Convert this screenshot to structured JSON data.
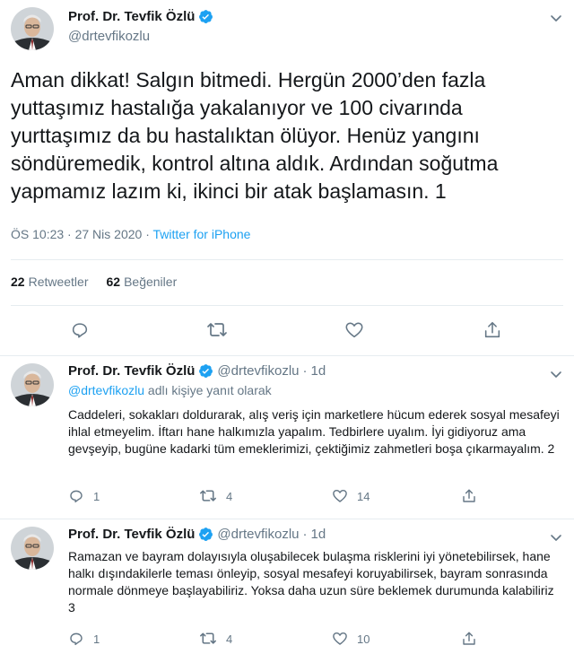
{
  "main_tweet": {
    "author_name": "Prof. Dr. Tevfik Özlü",
    "handle": "@drtevfikozlu",
    "text": "Aman dikkat! Salgın bitmedi. Hergün 2000’den fazla yuttaşımız hastalığa yakalanıyor ve 100 civarında yurttaşımız da bu hastalıktan ölüyor. Henüz yangını söndüremedik, kontrol altına aldık. Ardından soğutma yapmamız lazım ki, ikinci bir atak başlamasın. 1",
    "timestamp": "ÖS 10:23 · 27 Nis 2020 ·",
    "source": "Twitter for iPhone",
    "retweets_count": "22",
    "retweets_label": "Retweetler",
    "likes_count": "62",
    "likes_label": "Beğeniler"
  },
  "replies": [
    {
      "author_name": "Prof. Dr. Tevfik Özlü",
      "handle": "@drtevfikozlu",
      "dot": "·",
      "time": "1d",
      "reply_to_user": "@drtevfikozlu",
      "reply_to_suffix": "adlı kişiye yanıt olarak",
      "text": "Caddeleri, sokakları doldurarak, alış veriş için marketlere hücum ederek sosyal mesafeyi ihlal etmeyelim. İftarı hane halkımızla yapalım. Tedbirlere uyalım. İyi gidiyoruz ama gevşeyip, bugüne kadarki tüm emeklerimizi, çektiğimiz zahmetleri boşa çıkarmayalım. 2",
      "reply_count": "1",
      "retweet_count": "4",
      "like_count": "14"
    },
    {
      "author_name": "Prof. Dr. Tevfik Özlü",
      "handle": "@drtevfikozlu",
      "dot": "·",
      "time": "1d",
      "text": "Ramazan ve bayram dolayısıyla oluşabilecek bulaşma risklerini iyi yönetebilirsek, hane halkı dışındakilerle teması önleyip, sosyal mesafeyi koruyabilirsek, bayram sonrasında normale dönmeye başlayabiliriz. Yoksa daha uzun süre beklemek durumunda kalabiliriz 3",
      "reply_count": "1",
      "retweet_count": "4",
      "like_count": "10"
    }
  ],
  "colors": {
    "accent": "#1da1f2",
    "secondary_text": "#657786",
    "divider": "#e6ecf0",
    "verified": "#1da1f2"
  },
  "icons": [
    "chevron-down-icon",
    "verified-badge-icon",
    "reply-icon",
    "retweet-icon",
    "like-icon",
    "share-icon"
  ]
}
